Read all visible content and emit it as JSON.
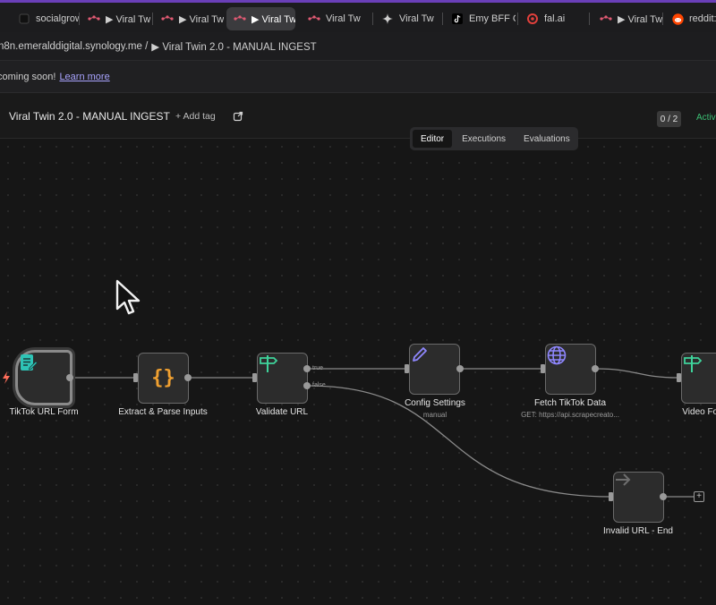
{
  "browser": {
    "tabs": [
      {
        "label": "socialgrow",
        "icon": "dark-square-icon"
      },
      {
        "label": "▶ Viral Tw",
        "icon": "n8n-logo-icon"
      },
      {
        "label": "▶ Viral Tw",
        "icon": "n8n-logo-icon"
      },
      {
        "label": "▶ Viral Tw",
        "icon": "n8n-logo-icon",
        "active": true
      },
      {
        "label": "Viral Tw",
        "icon": "n8n-logo-icon"
      },
      {
        "label": "Viral Tw",
        "icon": "gemini-icon"
      },
      {
        "label": "Emy BFF C",
        "icon": "tiktok-icon"
      },
      {
        "label": "fal.ai",
        "icon": "fal-icon"
      },
      {
        "label": "▶ Viral Tw",
        "icon": "n8n-logo-icon"
      },
      {
        "label": "reddit: t",
        "icon": "reddit-icon"
      }
    ]
  },
  "breadcrumb": {
    "host": "n8n.emeralddigital.synology.me /",
    "workflow": "▶ Viral Twin 2.0 - MANUAL INGEST"
  },
  "banner": {
    "text": "coming soon!",
    "link": "Learn more"
  },
  "header": {
    "title": "Viral Twin 2.0 - MANUAL INGEST",
    "add_tag": "+ Add tag",
    "counter": "0 / 2",
    "status": "Activ"
  },
  "view_tabs": [
    "Editor",
    "Executions",
    "Evaluations"
  ],
  "nodes": {
    "tiktok_form": {
      "label": "TikTok URL Form",
      "icon": "form-icon"
    },
    "extract_parse": {
      "label": "Extract & Parse Inputs",
      "icon": "code-braces-icon"
    },
    "validate_url": {
      "label": "Validate URL",
      "icon": "signpost-icon"
    },
    "config_settings": {
      "label": "Config Settings",
      "sub": "manual",
      "icon": "pencil-icon"
    },
    "fetch_tiktok": {
      "label": "Fetch TikTok Data",
      "sub": "GET: https://api.scrapecreato...",
      "icon": "globe-icon"
    },
    "video_found": {
      "label": "Video Fou",
      "icon": "signpost-icon"
    },
    "invalid_url": {
      "label": "Invalid URL - End",
      "icon": "arrow-right-icon"
    }
  },
  "edge_labels": {
    "true": "true",
    "false": "false"
  },
  "colors": {
    "accent": "#7c74ff",
    "active": "#3cbf74",
    "form_icon": "#2ec4b6",
    "braces_icon": "#f0a030",
    "signpost_icon": "#3ed39b",
    "pencil_icon": "#8f87ff",
    "globe_icon": "#8f87ff"
  }
}
